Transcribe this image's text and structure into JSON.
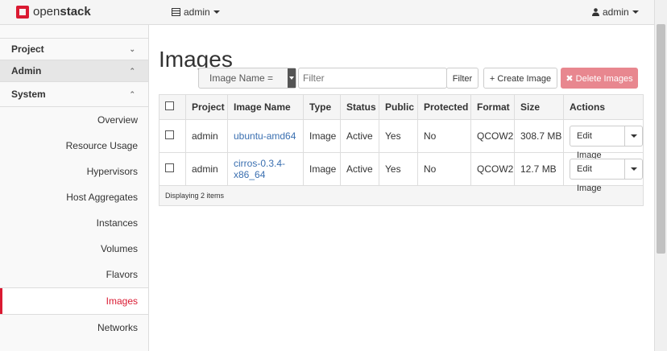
{
  "topbar": {
    "brand": "openstack",
    "project_selector": "admin",
    "user_menu": "admin"
  },
  "sidebar": {
    "sections": [
      {
        "label": "Project",
        "state": "collapsed"
      },
      {
        "label": "Admin",
        "state": "expanded"
      },
      {
        "label": "System",
        "state": "expanded"
      }
    ],
    "items": [
      {
        "label": "Overview"
      },
      {
        "label": "Resource Usage"
      },
      {
        "label": "Hypervisors"
      },
      {
        "label": "Host Aggregates"
      },
      {
        "label": "Instances"
      },
      {
        "label": "Volumes"
      },
      {
        "label": "Flavors"
      },
      {
        "label": "Images",
        "active": true
      },
      {
        "label": "Networks"
      }
    ]
  },
  "main": {
    "title": "Images",
    "filter": {
      "field_select": "Image Name =",
      "placeholder": "Filter",
      "value": "",
      "filter_button": "Filter"
    },
    "create_button": "Create Image",
    "delete_button": "Delete Images",
    "table": {
      "columns": [
        "Project",
        "Image Name",
        "Type",
        "Status",
        "Public",
        "Protected",
        "Format",
        "Size",
        "Actions"
      ],
      "rows": [
        {
          "project": "admin",
          "name": "ubuntu-amd64",
          "type": "Image",
          "status": "Active",
          "public": "Yes",
          "protected": "No",
          "format": "QCOW2",
          "size": "308.7 MB",
          "action": "Edit Image"
        },
        {
          "project": "admin",
          "name": "cirros-0.3.4-x86_64",
          "type": "Image",
          "status": "Active",
          "public": "Yes",
          "protected": "No",
          "format": "QCOW2",
          "size": "12.7 MB",
          "action": "Edit Image"
        }
      ],
      "footer": "Displaying 2 items"
    }
  },
  "colors": {
    "accent": "#da1a32",
    "link": "#3a6fb0",
    "delete_button": "#e8878f"
  },
  "icons": {
    "logo": "openstack-logo-icon",
    "project_selector": "server-icon",
    "user": "user-icon",
    "create": "plus-icon",
    "delete": "x-icon"
  }
}
